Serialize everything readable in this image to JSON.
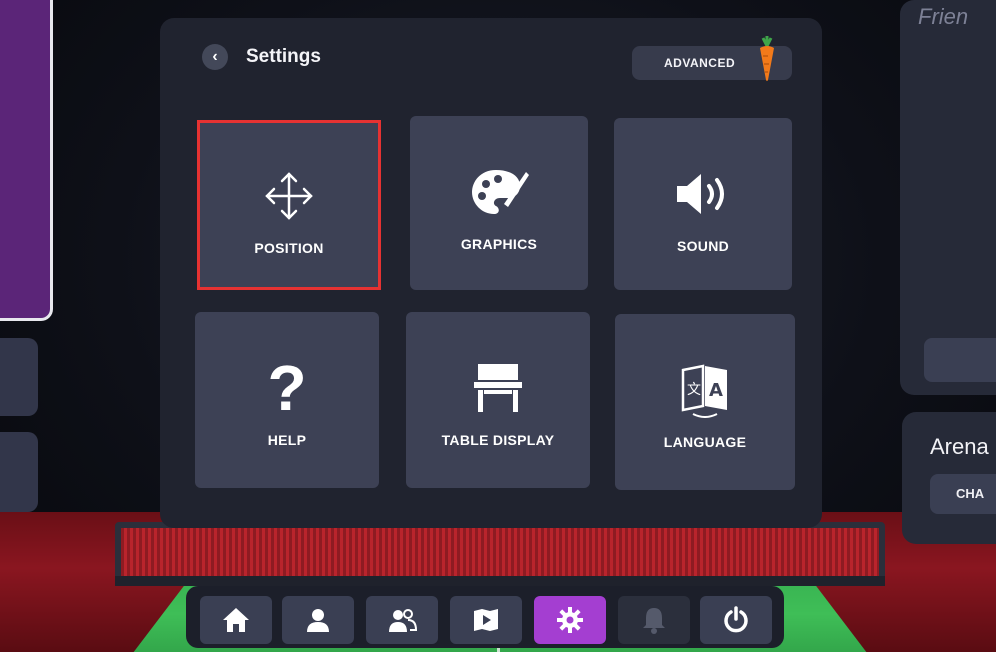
{
  "settings": {
    "title": "Settings",
    "advanced_label": "ADVANCED",
    "tiles": [
      {
        "label": "POSITION",
        "icon": "move-arrows-icon"
      },
      {
        "label": "GRAPHICS",
        "icon": "palette-icon"
      },
      {
        "label": "SOUND",
        "icon": "speaker-icon"
      },
      {
        "label": "HELP",
        "icon": "question-icon"
      },
      {
        "label": "TABLE DISPLAY",
        "icon": "table-icon"
      },
      {
        "label": "LANGUAGE",
        "icon": "translate-icon"
      }
    ]
  },
  "right_panel": {
    "title_partial": "Frien",
    "arena_label": "Arena",
    "challenge_partial": "CHA"
  },
  "dock": {
    "items": [
      {
        "icon": "home-icon",
        "state": "normal"
      },
      {
        "icon": "profile-icon",
        "state": "normal"
      },
      {
        "icon": "friends-icon",
        "state": "normal"
      },
      {
        "icon": "map-icon",
        "state": "normal"
      },
      {
        "icon": "gear-icon",
        "state": "active"
      },
      {
        "icon": "bell-icon",
        "state": "disabled"
      },
      {
        "icon": "power-icon",
        "state": "normal"
      }
    ]
  },
  "colors": {
    "accent_active": "#a43ed1",
    "highlight_box": "#e63232",
    "tile_bg": "#3d4155"
  }
}
